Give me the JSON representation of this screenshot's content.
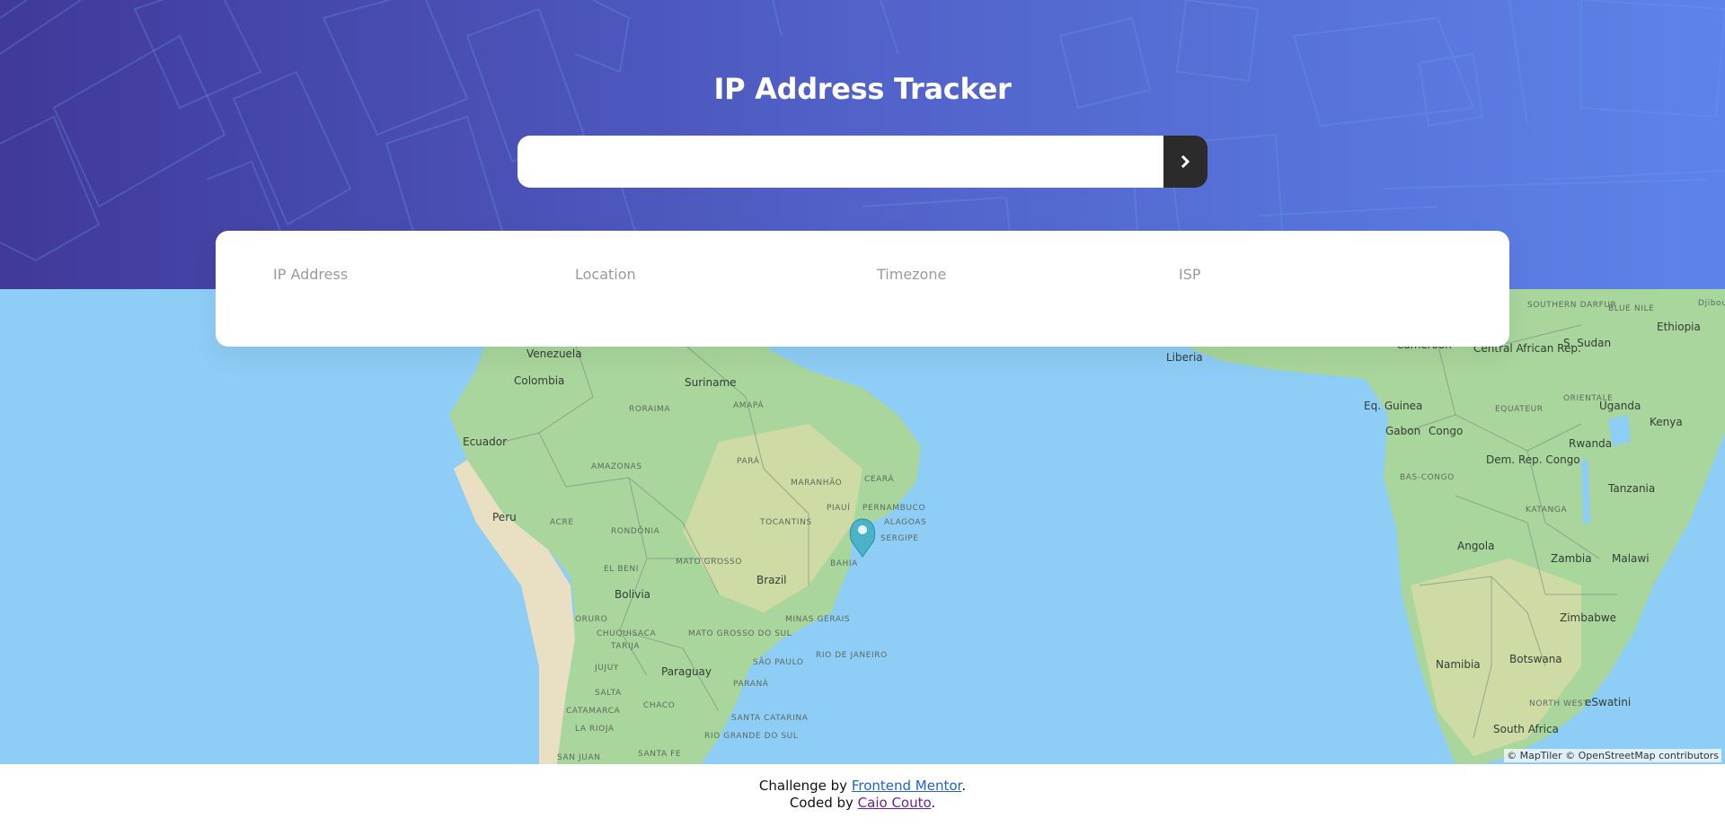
{
  "header": {
    "title": "IP Address Tracker",
    "search": {
      "value": "",
      "placeholder": "",
      "button_icon": "chevron-right-icon"
    }
  },
  "info": {
    "ip_address_label": "IP Address",
    "ip_address_value": "",
    "location_label": "Location",
    "location_value": "",
    "timezone_label": "Timezone",
    "timezone_value": "",
    "isp_label": "ISP",
    "isp_value": ""
  },
  "map": {
    "labels": {
      "venezuela": "Venezuela",
      "colombia": "Colombia",
      "suriname": "Suriname",
      "roraima": "RORAIMA",
      "amapa": "AMAPÁ",
      "ecuador": "Ecuador",
      "amazonas": "AMAZONAS",
      "para": "PARÁ",
      "maranhao": "MARANHÃO",
      "ceara": "CEARÁ",
      "piaui": "PIAUÍ",
      "pernambuco": "PERNAMBUCO",
      "alagoas": "ALAGOAS",
      "sergipe": "SERGIPE",
      "peru": "Peru",
      "acre": "ACRE",
      "rondonia": "RONDÔNIA",
      "tocantins": "TOCANTINS",
      "bahia": "BAHIA",
      "el_beni": "EL BENI",
      "mato_grosso": "MATO GROSSO",
      "brazil": "Brazil",
      "bolivia": "Bolivia",
      "oruro": "ORURO",
      "chuquisaca": "CHUQUISACA",
      "minas_gerais": "MINAS GERAIS",
      "tarija": "TARIJA",
      "mato_grosso_do_sul": "MATO GROSSO DO SUL",
      "jujuy": "JUJUY",
      "sao_paulo": "SÃO PAULO",
      "rio_de_janeiro": "RIO DE JANEIRO",
      "paraguay": "Paraguay",
      "parana": "PARANÁ",
      "salta": "SALTA",
      "chaco": "CHACO",
      "santa_catarina": "SANTA CATARINA",
      "la_rioja": "LA RIOJA",
      "catamarca": "CATAMARCA",
      "rio_grande_do_sul": "RIO GRANDE DO SUL",
      "san_juan": "SAN JUAN",
      "santa_fe": "SANTA FE",
      "liberia": "Liberia",
      "cameroon": "Cameroon",
      "central_african_rep": "Central African Rep.",
      "south_darfur": "SOUTHERN DARFUR",
      "blue_nile": "BLUE NILE",
      "ethiopia": "Ethiopia",
      "s_sudan": "S. Sudan",
      "djibouti": "Djibouti",
      "orientale": "ORIENTALE",
      "equateur": "EQUATEUR",
      "uganda": "Uganda",
      "kenya": "Kenya",
      "eq_guinea": "Eq. Guinea",
      "gabon": "Gabon",
      "congo": "Congo",
      "dem_rep_congo": "Dem. Rep. Congo",
      "rwanda": "Rwanda",
      "bas_congo": "BAS-CONGO",
      "tanzania": "Tanzania",
      "katanga": "KATANGA",
      "angola": "Angola",
      "zambia": "Zambia",
      "malawi": "Malawi",
      "zimbabwe": "Zimbabwe",
      "namibia": "Namibia",
      "botswana": "Botswana",
      "north_west": "NORTH WEST",
      "eswatini": "eSwatini",
      "south_africa": "South Africa"
    },
    "attribution": "© MapTiler © OpenStreetMap contributors",
    "colors": {
      "water": "#8ecdf6",
      "land": "#a9d6a0",
      "marker": "#4bb3c9"
    }
  },
  "footer": {
    "line1_prefix": "Challenge by ",
    "line1_link": "Frontend Mentor",
    "line1_suffix": ".",
    "line2_prefix": "Coded by ",
    "line2_link": "Caio Couto",
    "line2_suffix": "."
  }
}
